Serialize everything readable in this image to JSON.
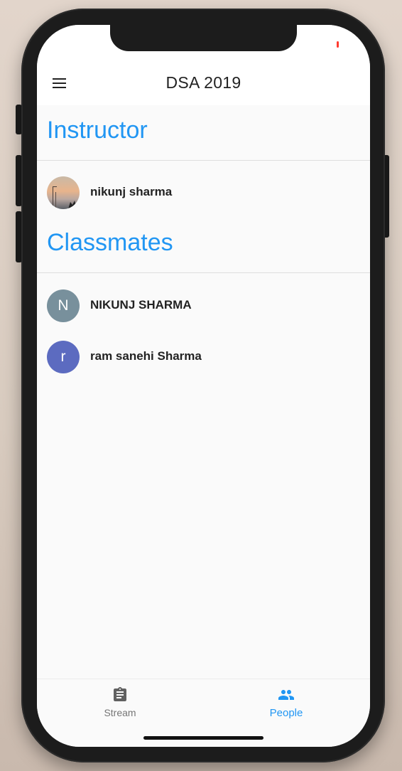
{
  "app_bar": {
    "title": "DSA 2019",
    "menu_icon": "hamburger-menu-icon"
  },
  "instructor_section": {
    "header": "Instructor",
    "people": [
      {
        "name": "nikunj sharma",
        "avatar": "photo"
      }
    ]
  },
  "classmates_section": {
    "header": "Classmates",
    "people": [
      {
        "name": "NIKUNJ SHARMA",
        "initial": "N",
        "avatar_color": "#78909c"
      },
      {
        "name": "ram sanehi Sharma",
        "initial": "r",
        "avatar_color": "#5c6bc0"
      }
    ]
  },
  "bottom_nav": {
    "items": [
      {
        "label": "Stream",
        "icon": "assignment-clipboard-icon",
        "active": false
      },
      {
        "label": "People",
        "icon": "people-icon",
        "active": true
      }
    ]
  },
  "colors": {
    "accent": "#2196f3",
    "inactive_nav": "#757575",
    "text": "#222222"
  }
}
